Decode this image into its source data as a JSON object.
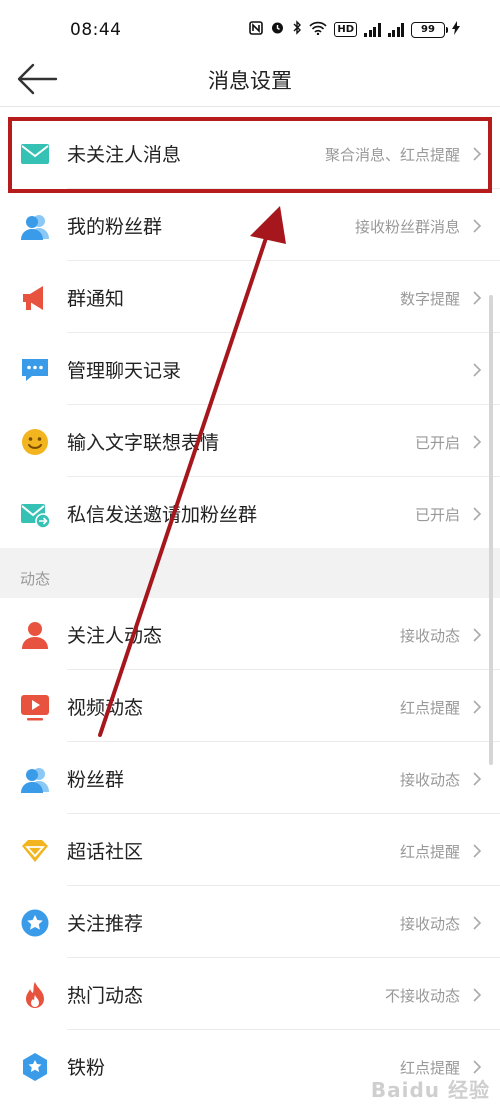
{
  "status_bar": {
    "time": "08:44",
    "battery": "99",
    "hd": "HD"
  },
  "header": {
    "title": "消息设置"
  },
  "rows_top": [
    {
      "label": "未关注人消息",
      "value": "聚合消息、红点提醒"
    },
    {
      "label": "我的粉丝群",
      "value": "接收粉丝群消息"
    },
    {
      "label": "群通知",
      "value": "数字提醒"
    },
    {
      "label": "管理聊天记录",
      "value": ""
    },
    {
      "label": "输入文字联想表情",
      "value": "已开启"
    },
    {
      "label": "私信发送邀请加粉丝群",
      "value": "已开启"
    }
  ],
  "section": {
    "title": "动态"
  },
  "rows_bottom": [
    {
      "label": "关注人动态",
      "value": "接收动态"
    },
    {
      "label": "视频动态",
      "value": "红点提醒"
    },
    {
      "label": "粉丝群",
      "value": "接收动态"
    },
    {
      "label": "超话社区",
      "value": "红点提醒"
    },
    {
      "label": "关注推荐",
      "value": "接收动态"
    },
    {
      "label": "热门动态",
      "value": "不接收动态"
    },
    {
      "label": "铁粉",
      "value": "红点提醒"
    }
  ],
  "watermark": "Baidu 经验",
  "colors": {
    "highlight": "#b71c1c",
    "arrow": "#a5171c",
    "teal": "#35c2b4",
    "blue": "#3a9be8",
    "red": "#e8533f",
    "yellow": "#f2b51f"
  }
}
